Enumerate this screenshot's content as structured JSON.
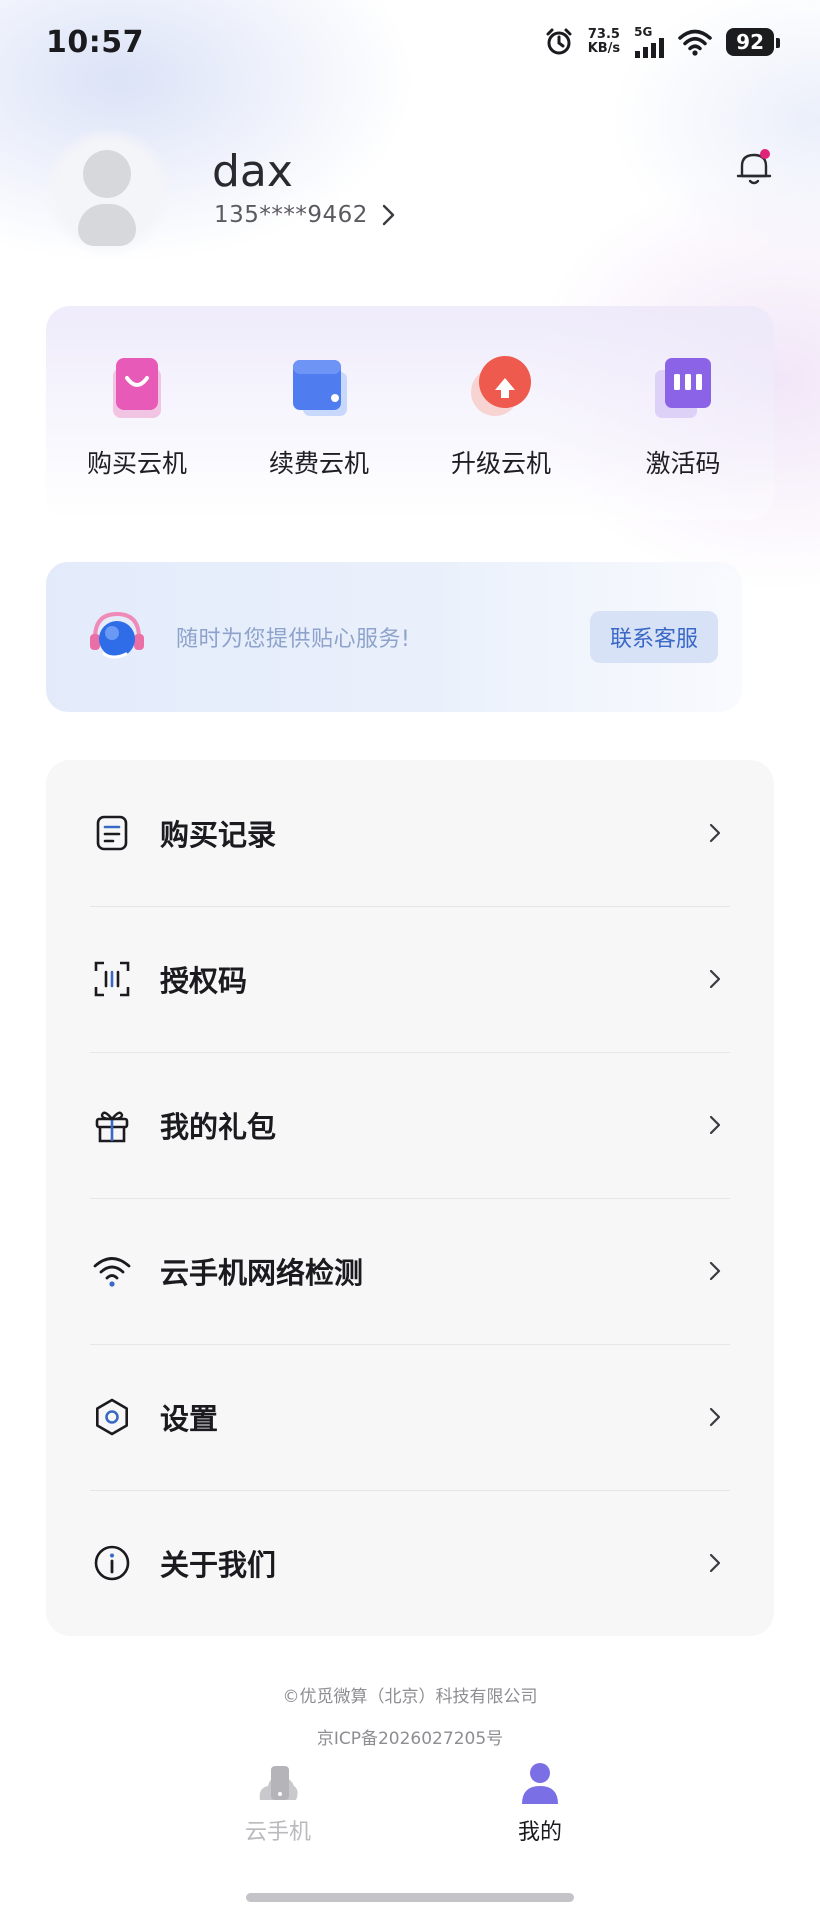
{
  "status_bar": {
    "time": "10:57",
    "net_speed_value": "73.5",
    "net_speed_unit": "KB/s",
    "network": "5G",
    "battery": "92",
    "icons": [
      "alarm-icon",
      "signal-icon",
      "wifi-icon",
      "battery-icon"
    ]
  },
  "profile": {
    "username": "dax",
    "phone": "135****9462",
    "notification_dot_color": "#e0247a"
  },
  "quick_actions": [
    {
      "label": "购买云机",
      "icon": "shopping-bag-icon",
      "color": "#e85ab8"
    },
    {
      "label": "续费云机",
      "icon": "wallet-icon",
      "color": "#4f7df0"
    },
    {
      "label": "升级云机",
      "icon": "upgrade-icon",
      "color": "#ef5a4f"
    },
    {
      "label": "激活码",
      "icon": "ticket-icon",
      "color": "#8b63e6"
    }
  ],
  "service": {
    "text": "随时为您提供贴心服务!",
    "button": "联系客服",
    "icon": "headset-icon"
  },
  "menu": [
    {
      "label": "购买记录",
      "icon": "document-icon"
    },
    {
      "label": "授权码",
      "icon": "scan-code-icon"
    },
    {
      "label": "我的礼包",
      "icon": "gift-icon"
    },
    {
      "label": "云手机网络检测",
      "icon": "wifi-icon"
    },
    {
      "label": "设置",
      "icon": "gear-icon"
    },
    {
      "label": "关于我们",
      "icon": "info-icon"
    }
  ],
  "footer": {
    "copyright": "©优觅微算（北京）科技有限公司",
    "icp": "京ICP备2026027205号"
  },
  "tabs": [
    {
      "label": "云手机",
      "icon": "cloud-phone-icon",
      "active": false
    },
    {
      "label": "我的",
      "icon": "person-icon",
      "active": true
    }
  ],
  "colors": {
    "accent": "#3a68c6",
    "active_tab": "#1b1b1f",
    "inactive_tab": "#b9b9be",
    "active_tab_icon": "#7b6fe6"
  }
}
